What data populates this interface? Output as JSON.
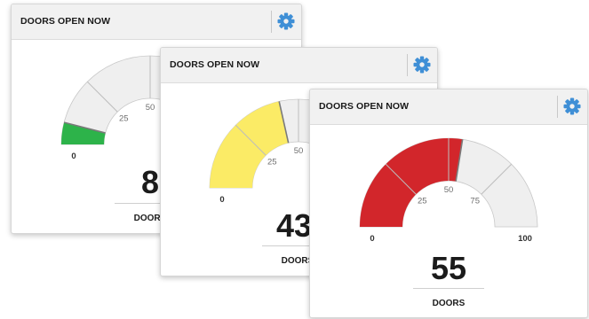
{
  "widgets": [
    {
      "title": "DOORS OPEN NOW",
      "value": 8,
      "value_text": "8",
      "unit_label": "DOORS",
      "min": 0,
      "max": 100,
      "scale_ticks": [
        {
          "value": 0,
          "label": "0"
        },
        {
          "value": 25,
          "label": "25"
        },
        {
          "value": 50,
          "label": "50"
        }
      ],
      "fill_color": "#2db34a"
    },
    {
      "title": "DOORS OPEN NOW",
      "value": 43,
      "value_text": "43",
      "unit_label": "DOORS",
      "min": 0,
      "max": 100,
      "scale_ticks": [
        {
          "value": 0,
          "label": "0"
        },
        {
          "value": 25,
          "label": "25"
        },
        {
          "value": 50,
          "label": "50"
        }
      ],
      "fill_color": "#fbeb66"
    },
    {
      "title": "DOORS OPEN NOW",
      "value": 55,
      "value_text": "55",
      "unit_label": "DOORS",
      "min": 0,
      "max": 100,
      "scale_ticks": [
        {
          "value": 0,
          "label": "0"
        },
        {
          "value": 25,
          "label": "25"
        },
        {
          "value": 50,
          "label": "50"
        },
        {
          "value": 75,
          "label": "75"
        },
        {
          "value": 100,
          "label": "100"
        }
      ],
      "fill_color": "#d2262b"
    }
  ],
  "colors": {
    "track": "#efefef",
    "gear": "#3f8fd6"
  },
  "icons": {
    "settings": "gear-icon"
  }
}
